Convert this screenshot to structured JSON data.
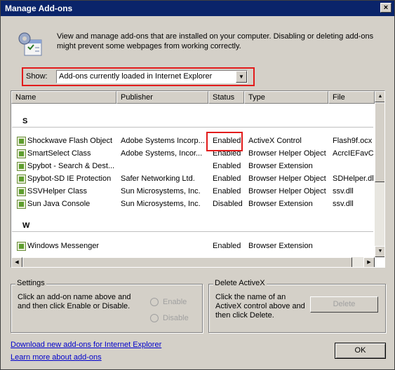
{
  "window": {
    "title": "Manage Add-ons",
    "close_glyph": "×"
  },
  "header": {
    "icon": "gear-add-ons-icon",
    "description": "View and manage add-ons that are installed on your computer. Disabling or deleting add-ons might prevent some webpages from working correctly."
  },
  "show": {
    "label": "Show:",
    "selected": "Add-ons currently loaded in Internet Explorer",
    "arrow_glyph": "▼"
  },
  "list": {
    "columns": [
      "Name",
      "Publisher",
      "Status",
      "Type",
      "File"
    ],
    "groups": [
      {
        "label": "S",
        "rows": [
          {
            "name": "Shockwave Flash Object",
            "publisher": "Adobe Systems Incorp...",
            "status": "Enabled",
            "type": "ActiveX Control",
            "file": "Flash9f.ocx"
          },
          {
            "name": "SmartSelect Class",
            "publisher": "Adobe Systems, Incor...",
            "status": "Enabled",
            "type": "Browser Helper Object",
            "file": "AcrcIEFavCli"
          },
          {
            "name": "Spybot - Search & Dest...",
            "publisher": "",
            "status": "Enabled",
            "type": "Browser Extension",
            "file": ""
          },
          {
            "name": "Spybot-SD IE Protection",
            "publisher": "Safer Networking Ltd.",
            "status": "Enabled",
            "type": "Browser Helper Object",
            "file": "SDHelper.dll"
          },
          {
            "name": "SSVHelper Class",
            "publisher": "Sun Microsystems, Inc.",
            "status": "Enabled",
            "type": "Browser Helper Object",
            "file": "ssv.dll"
          },
          {
            "name": "Sun Java Console",
            "publisher": "Sun Microsystems, Inc.",
            "status": "Disabled",
            "type": "Browser Extension",
            "file": "ssv.dll"
          }
        ]
      },
      {
        "label": "W",
        "rows": [
          {
            "name": "Windows Messenger",
            "publisher": "",
            "status": "Enabled",
            "type": "Browser Extension",
            "file": ""
          }
        ]
      }
    ],
    "scroll_up_glyph": "▲",
    "scroll_down_glyph": "▼",
    "scroll_left_glyph": "◀",
    "scroll_right_glyph": "▶"
  },
  "settings": {
    "title": "Settings",
    "text": "Click an add-on name above and and then click Enable or Disable.",
    "enable_label": "Enable",
    "disable_label": "Disable"
  },
  "delete_activex": {
    "title": "Delete ActiveX",
    "text": "Click the name of an ActiveX control above and then click Delete.",
    "delete_label": "Delete"
  },
  "links": {
    "download": "Download new add-ons for Internet Explorer",
    "learn": "Learn more about add-ons"
  },
  "ok_label": "OK"
}
